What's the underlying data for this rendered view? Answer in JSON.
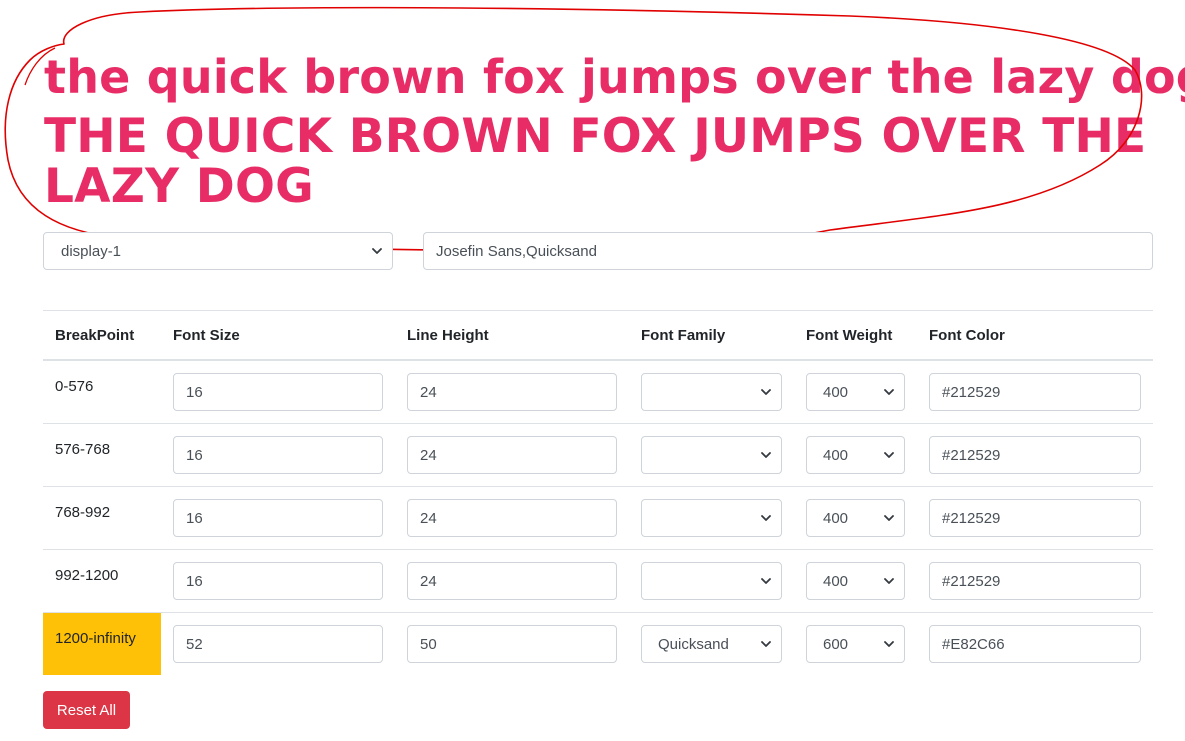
{
  "preview": {
    "lowercase_text": "the quick brown fox jumps over the lazy dog",
    "uppercase_text": "THE QUICK BROWN FOX JUMPS OVER THE LAZY DOG"
  },
  "controls": {
    "style_select_value": "display-1",
    "font_families_value": "Josefin Sans,Quicksand"
  },
  "table": {
    "headers": [
      "BreakPoint",
      "Font Size",
      "Line Height",
      "Font Family",
      "Font Weight",
      "Font Color"
    ],
    "rows": [
      {
        "breakpoint": "0-576",
        "font_size": "16",
        "line_height": "24",
        "font_family": "",
        "font_weight": "400",
        "font_color": "#212529"
      },
      {
        "breakpoint": "576-768",
        "font_size": "16",
        "line_height": "24",
        "font_family": "",
        "font_weight": "400",
        "font_color": "#212529"
      },
      {
        "breakpoint": "768-992",
        "font_size": "16",
        "line_height": "24",
        "font_family": "",
        "font_weight": "400",
        "font_color": "#212529"
      },
      {
        "breakpoint": "992-1200",
        "font_size": "16",
        "line_height": "24",
        "font_family": "",
        "font_weight": "400",
        "font_color": "#212529"
      },
      {
        "breakpoint": "1200-infinity",
        "font_size": "52",
        "line_height": "50",
        "font_family": "Quicksand",
        "font_weight": "600",
        "font_color": "#E82C66",
        "active": true
      }
    ]
  },
  "reset_label": "Reset All",
  "colors": {
    "preview_text": "#E82C66",
    "active_breakpoint": "#FFC107",
    "reset_button": "#DC3545",
    "annotation_stroke": "#E00000"
  },
  "icons": {
    "select_arrow": "chevron-down-icon"
  }
}
